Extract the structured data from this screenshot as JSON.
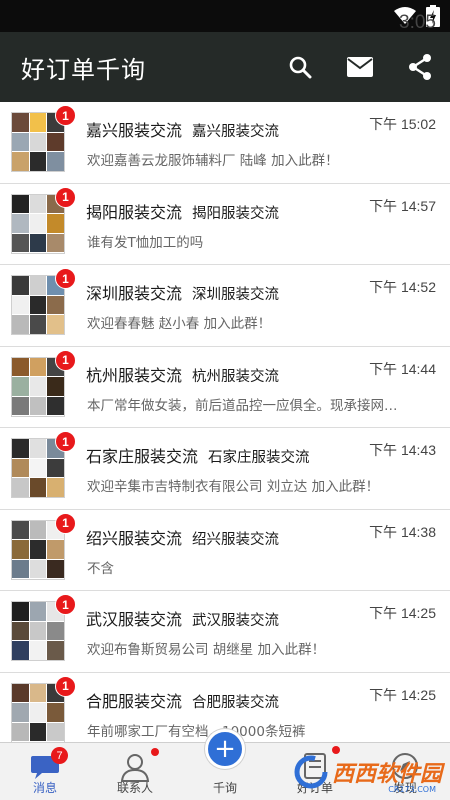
{
  "status_bar": {
    "time": "3:05",
    "icons": [
      "wifi-icon",
      "battery-charging-icon"
    ]
  },
  "app_bar": {
    "title": "好订单千询",
    "actions": [
      "search-icon",
      "mail-icon",
      "share-icon"
    ]
  },
  "conversations": [
    {
      "name": "嘉兴服装交流",
      "sub": "嘉兴服装交流",
      "time": "下午 15:02",
      "message": "欢迎嘉善云龙服饰辅料厂 陆峰 加入此群！",
      "badge": "1"
    },
    {
      "name": "揭阳服装交流",
      "sub": "揭阳服装交流",
      "time": "下午 14:57",
      "message": "谁有发T恤加工的吗",
      "badge": "1"
    },
    {
      "name": "深圳服装交流",
      "sub": "深圳服装交流",
      "time": "下午 14:52",
      "message": "欢迎春春魅 赵小春 加入此群！",
      "badge": "1"
    },
    {
      "name": "杭州服装交流",
      "sub": "杭州服装交流",
      "time": "下午 14:44",
      "message": "本厂常年做女装，前后道品控一应俱全。现承接网…",
      "badge": "1"
    },
    {
      "name": "石家庄服装交流",
      "sub": "石家庄服装交流",
      "time": "下午 14:43",
      "message": "欢迎辛集市吉特制衣有限公司 刘立达 加入此群！",
      "badge": "1"
    },
    {
      "name": "绍兴服装交流",
      "sub": "绍兴服装交流",
      "time": "下午 14:38",
      "message": "不含",
      "badge": "1"
    },
    {
      "name": "武汉服装交流",
      "sub": "武汉服装交流",
      "time": "下午 14:25",
      "message": "欢迎布鲁斯贸易公司 胡继星 加入此群！",
      "badge": "1"
    },
    {
      "name": "合肥服装交流",
      "sub": "合肥服装交流",
      "time": "下午 14:25",
      "message": "年前哪家工厂有空档，10000条短裤",
      "badge": "1"
    }
  ],
  "tab_bar": {
    "tabs": [
      {
        "label": "消息",
        "icon": "chat-bubble-icon",
        "badge": "7"
      },
      {
        "label": "联系人",
        "icon": "contact-person-icon"
      },
      {
        "label": "千询",
        "icon": "plus-icon",
        "glyph": "+"
      },
      {
        "label": "好订单",
        "icon": "order-icon"
      },
      {
        "label": "发现",
        "icon": "discover-icon"
      }
    ]
  },
  "watermark": {
    "text": "西西软件园",
    "url": "CR173.COM"
  },
  "colors": {
    "app_bar": "#252a28",
    "badge": "#e8191b",
    "accent": "#2f6fd6"
  }
}
